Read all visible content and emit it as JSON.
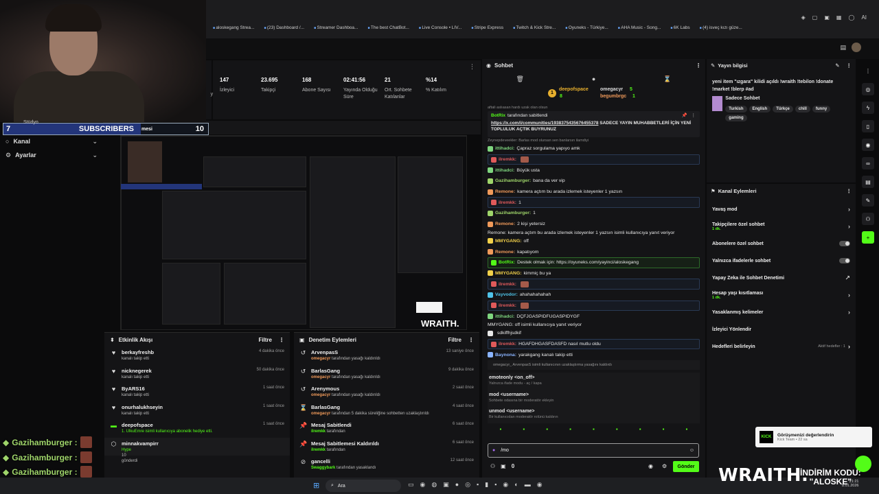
{
  "bookmarks": [
    "aloskegang Strea...",
    "(23) Dashboard /...",
    "Streamer Dashboa...",
    "The best ChatBot...",
    "Live Console • LIV...",
    "Stripe Express",
    "Twitch & Kick Stre...",
    "Oyuneks - Türkiye...",
    "AHA Music - Song...",
    "6K Labs",
    "(4) isveç kızı güze..."
  ],
  "window_ai_label": "AI",
  "overlay": {
    "subscribers_count": "7",
    "subscribers_label": "SUBSCRIBERS",
    "subscribers_goal": "10",
    "sub_tail": "mesi",
    "chatbox_name": "Gazihamburger :",
    "promo_brand": "WRAITH.",
    "promo_line1": "İNDİRİM KODU:",
    "promo_code": "\"ALOSKE\""
  },
  "leftnav": {
    "items": [
      {
        "label": "Kanal"
      },
      {
        "label": "Ayarlar"
      }
    ],
    "partial_label": "Stüdyo"
  },
  "stats": {
    "left_partial": "yın",
    "items": [
      {
        "value": "147",
        "label": "İzleyici"
      },
      {
        "value": "23.695",
        "label": "Takipçi"
      },
      {
        "value": "168",
        "label": "Abone Sayısı"
      },
      {
        "value": "02:41:56",
        "label": "Yayında Olduğu Süre"
      },
      {
        "value": "21",
        "label": "Ort. Sohbete Katılanlar"
      },
      {
        "value": "%14",
        "label": "% Katılım"
      }
    ]
  },
  "activity": {
    "title": "Etkinlik Akışı",
    "filter": "Filtre",
    "items": [
      {
        "name": "berkayfreshb",
        "sub": "kanalı takip etti",
        "time": "4 dakika önce"
      },
      {
        "name": "nicknegerek",
        "sub": "kanalı takip etti",
        "time": "50 dakika önce"
      },
      {
        "name": "ByARS16",
        "sub": "kanalı takip etti",
        "time": "1 saat önce"
      },
      {
        "name": "onurhalukhseyin",
        "sub": "kanalı takip etti",
        "time": "1 saat önce"
      },
      {
        "name": "deepofspace",
        "sub": "1. UlkuEmre isimli kullanıcıya abonelik hediye etti.",
        "time": "1 saat önce"
      },
      {
        "name": "minnakvampirr",
        "sub": "Hype",
        "time": ""
      }
    ],
    "last_extra": "10",
    "last_extra2": "gönderdi"
  },
  "moderation": {
    "title": "Denetim Eylemleri",
    "filter": "Filtre",
    "items": [
      {
        "name": "ArvenpasS",
        "who": "omegacyr",
        "sub": "tarafından yasağı kaldırıldı",
        "time": "13 saniye önce"
      },
      {
        "name": "BarlasGang",
        "who": "omegacyr",
        "sub": "tarafından yasağı kaldırıldı",
        "time": "9 dakika önce"
      },
      {
        "name": "Arenymous",
        "who": "omegacyr",
        "sub": "tarafından yasağı kaldırıldı",
        "time": "2 saat önce"
      },
      {
        "name": "BarlasGang",
        "who": "omegacyr",
        "sub": "tarafından 5 dakika süreliğine sohbetten uzaklaştırıldı",
        "time": "4 saat önce"
      },
      {
        "name": "Mesaj Sabitlendi",
        "who": "ilremkk",
        "sub": "tarafından",
        "time": "6 saat önce"
      },
      {
        "name": "Mesaj Sabitlemesi Kaldırıldı",
        "who": "ilremkk",
        "sub": "tarafından",
        "time": "6 saat önce"
      },
      {
        "name": "gancelli",
        "who": "Swaggybark",
        "sub": "tarafından yasaklandı",
        "time": "12 saat önce"
      }
    ]
  },
  "chat": {
    "title": "Sohbet",
    "featured": {
      "user1": "deepofspace",
      "user1_count": "8",
      "user2": "omegacyr",
      "user2_count": "5",
      "user3": "begumbrgc",
      "user3_count": "1"
    },
    "top_partial": "aftali aslıasan hardı uzak olan olsun",
    "pinned_by": "BotRix",
    "pinned_by_suffix": "tarafından sabitlendi",
    "pinned_link": "https://x.com/i/communities/1938375435676455378",
    "pinned_text": "SADECE YAYIN MUHABBETLERİ İÇİN YENİ TOPLULUK AÇTIK BUYRUNUZ",
    "pinned_partial": "Zeynepdeveekler: Barlas mod olursan sen banlarsın ilamdiyi",
    "messages": [
      {
        "user": "ittihadci:",
        "text": "Çapraz sorgulama yapıyo amk",
        "color": "#7fd67f",
        "style": ""
      },
      {
        "user": "ilremkk:",
        "text": "",
        "color": "#e05a5a",
        "style": "bl"
      },
      {
        "user": "ittihadci:",
        "text": "Büyük usta",
        "color": "#7fd67f",
        "style": ""
      },
      {
        "user": "Gazihamburger:",
        "text": "bana da ver vip",
        "color": "#9fd56a",
        "style": ""
      },
      {
        "user": "Remone:",
        "text": "kamera açtım bu arada izlemek isteyenler 1 yazsın",
        "color": "#f09a5a",
        "style": ""
      },
      {
        "user": "ilremkk:",
        "text": "1",
        "color": "#e05a5a",
        "style": "bl"
      },
      {
        "user": "Gazihamburger:",
        "text": "1",
        "color": "#9fd56a",
        "style": ""
      },
      {
        "user": "Remone:",
        "text": "2 kişi yetersiz",
        "color": "#f09a5a",
        "style": ""
      },
      {
        "user": "MMYGANG:",
        "text": "off",
        "color": "#f2d14a",
        "style": "",
        "reply": "Remone: kamera açtım bu arada izlemek isteyenler 1 yazsın isimli kullanıcıya yanıt veriyor"
      },
      {
        "user": "Remone:",
        "text": "kapatıyom",
        "color": "#f09a5a",
        "style": ""
      },
      {
        "user": "BotRix:",
        "text": "Destek olmak için: https://oyuneks.com/yayinci/aloskegang",
        "color": "#53fc18",
        "style": "hl"
      },
      {
        "user": "MMYGANG:",
        "text": "kimmiç bu ya",
        "color": "#f2d14a",
        "style": ""
      },
      {
        "user": "ilremkk:",
        "text": "",
        "color": "#e05a5a",
        "style": "bl"
      },
      {
        "user": "Vayvodor:",
        "text": "ahahahahahah",
        "color": "#4fc3e8",
        "style": ""
      },
      {
        "user": "ilremkk:",
        "text": "",
        "color": "#e05a5a",
        "style": "bl"
      },
      {
        "user": "ittihadci:",
        "text": "DÇFJGASPIDFUGASPIDYGF",
        "color": "#7fd67f",
        "style": ""
      },
      {
        "user": "",
        "text": "sdkiffhjsdkif",
        "color": "#e8e8e8",
        "style": "",
        "reply": "MMYGANG: off isimli kullanıcıya yanıt veriyor"
      },
      {
        "user": "ilremkk:",
        "text": "HGAFDHGASFDASFD nasıl mutlu oldu",
        "color": "#e05a5a",
        "style": "bl"
      },
      {
        "user": "Baynona:",
        "text": "yarakgang kanalı takip etti",
        "color": "#8ab4ff",
        "style": ""
      }
    ],
    "unban_notice": "omegacyr_ ArvenpasS isimli kullanıcının uzaklaştırma yasağını kaldırdı",
    "commands": [
      {
        "cmd": "emoteonly <on_off>",
        "desc": "Yalnızca ifade modu - aç / kapa"
      },
      {
        "cmd": "mod <username>",
        "desc": "Sohbete odasına bir moderatör ekleyin"
      },
      {
        "cmd": "unmod <username>",
        "desc": "Bir kullanıcıdan moderatör rolünü kaldırın"
      }
    ],
    "input_value": "/mo",
    "points": "0",
    "send_label": "Gönder"
  },
  "stream_info": {
    "title": "Yayın bilgisi",
    "text": "yeni item \"ızgara\" kilidi açıldı !wraith !tebilon !donate !market !blerp #ad",
    "category": "Sadece Sohbet",
    "tags": [
      "Turkish",
      "English",
      "Türkçe",
      "chill",
      "funny",
      "gaming"
    ]
  },
  "channel_actions": {
    "title": "Kanal Eylemleri",
    "items": [
      {
        "label": "Yavaş mod",
        "sub": "",
        "kind": "chev"
      },
      {
        "label": "Takipçilere özel sohbet",
        "sub": "1 dk.",
        "kind": "chev"
      },
      {
        "label": "Abonelere özel sohbet",
        "sub": "",
        "kind": "toggle"
      },
      {
        "label": "Yalnızca ifadelerle sohbet",
        "sub": "",
        "kind": "toggle"
      },
      {
        "label": "Yapay Zeka ile Sohbet Denetimi",
        "sub": "",
        "kind": "ext"
      },
      {
        "label": "Hesap yaşı kısıtlaması",
        "sub": "1 dk.",
        "kind": "chev"
      },
      {
        "label": "Yasaklanmış kelimeler",
        "sub": "",
        "kind": "chev"
      },
      {
        "label": "İzleyici Yönlendir",
        "sub": "",
        "kind": "none"
      },
      {
        "label": "Hedefleri belirleyin",
        "sub": "",
        "kind": "goal",
        "extra": "Aktif hedefler : 1"
      }
    ]
  },
  "toast": {
    "title": "Görüşmenizi değerlendirin",
    "sub": "Kick Team • 22 sa"
  },
  "taskbar": {
    "search": "Ara",
    "time": "21:21",
    "date": "8.01.2026"
  },
  "colors": {
    "accent": "#53fc18",
    "bg": "#141416"
  }
}
